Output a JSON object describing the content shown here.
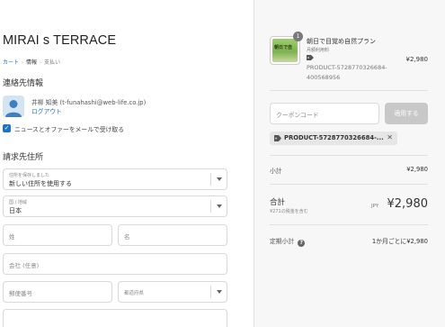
{
  "store_name": "MIRAI s TERRACE",
  "breadcrumb": {
    "items": [
      "カート",
      "情報",
      "支払い"
    ],
    "separator": "›"
  },
  "contact": {
    "title": "連絡先情報",
    "user": "井柳 知美 (t-funahashi@web-life.co.jp)",
    "logout": "ログアウト",
    "newsletter_label": "ニュースとオファーをメールで受け取る",
    "newsletter_checked": true
  },
  "billing": {
    "title": "請求先住所",
    "saved_address_label": "住所を保存しました",
    "saved_address_value": "新しい住所を使用する",
    "country_label": "国 / 地域",
    "country_value": "日本",
    "last_name_placeholder": "姓",
    "first_name_placeholder": "名",
    "company_placeholder": "会社 (任意)",
    "postal_placeholder": "郵便番号",
    "prefecture_placeholder": "都道府県"
  },
  "order": {
    "quantity": "1",
    "thumbnail_text": "朝日で自",
    "product_name": "朝日で目覚め自然プラン",
    "product_subtitle": "月額利用料",
    "product_code": "PRODUCT-5728770326684-400568956",
    "product_price": "¥2,980",
    "coupon_placeholder": "クーポンコード",
    "apply_label": "適用する",
    "applied_code": "PRODUCT-5728770326684-...",
    "subtotal_label": "小計",
    "subtotal_value": "¥2,980",
    "total_label": "合計",
    "total_tax_note": "¥271の税金を含む",
    "total_currency": "JPY",
    "total_value": "¥2,980",
    "recurring_label": "定期小計",
    "recurring_value": "1か月ごとに¥2,980"
  },
  "colors": {
    "accent": "#1a73c9",
    "sidebar_bg": "#f7f7f7",
    "apply_disabled": "#c8c8c8"
  }
}
